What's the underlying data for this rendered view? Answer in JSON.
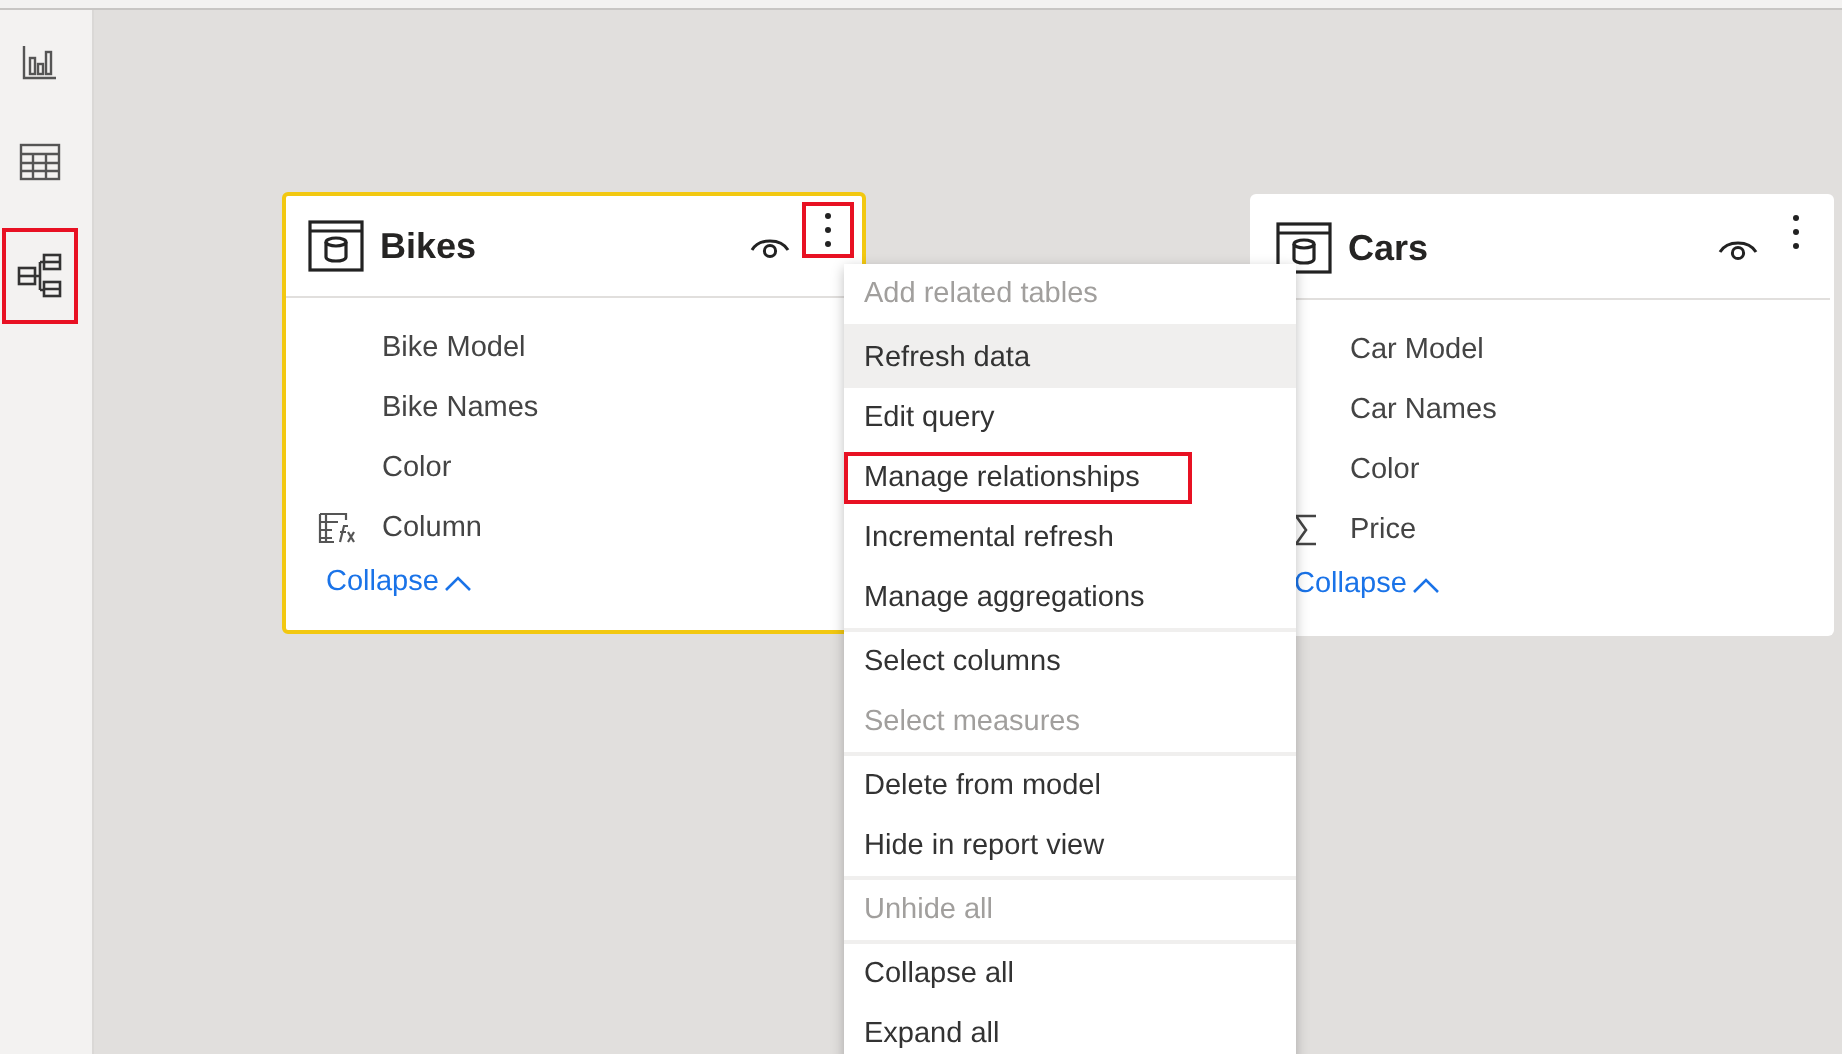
{
  "nav": [
    {
      "kind": "report",
      "highlighted": false
    },
    {
      "kind": "data",
      "highlighted": false
    },
    {
      "kind": "model",
      "highlighted": true
    }
  ],
  "tables": [
    {
      "name": "Bikes",
      "selected": true,
      "more_highlighted": true,
      "collapse_label": "Collapse",
      "fields": [
        {
          "name": "Bike Model",
          "kind": "column"
        },
        {
          "name": "Bike Names",
          "kind": "column"
        },
        {
          "name": "Color",
          "kind": "column"
        },
        {
          "name": "Column",
          "kind": "calculated"
        }
      ]
    },
    {
      "name": "Cars",
      "selected": false,
      "more_highlighted": false,
      "collapse_label": "Collapse",
      "fields": [
        {
          "name": "Car Model",
          "kind": "column"
        },
        {
          "name": "Car Names",
          "kind": "column"
        },
        {
          "name": "Color",
          "kind": "column"
        },
        {
          "name": "Price",
          "kind": "sum"
        }
      ]
    }
  ],
  "menu": {
    "groups": [
      [
        {
          "label": "Add related tables",
          "disabled": true,
          "hovered": false,
          "highlighted": false
        }
      ],
      [
        {
          "label": "Refresh data",
          "disabled": false,
          "hovered": true,
          "highlighted": false
        },
        {
          "label": "Edit query",
          "disabled": false,
          "hovered": false,
          "highlighted": false
        },
        {
          "label": "Manage relationships",
          "disabled": false,
          "hovered": false,
          "highlighted": true
        },
        {
          "label": "Incremental refresh",
          "disabled": false,
          "hovered": false,
          "highlighted": false
        },
        {
          "label": "Manage aggregations",
          "disabled": false,
          "hovered": false,
          "highlighted": false
        }
      ],
      [
        {
          "label": "Select columns",
          "disabled": false,
          "hovered": false,
          "highlighted": false
        },
        {
          "label": "Select measures",
          "disabled": true,
          "hovered": false,
          "highlighted": false
        }
      ],
      [
        {
          "label": "Delete from model",
          "disabled": false,
          "hovered": false,
          "highlighted": false
        },
        {
          "label": "Hide in report view",
          "disabled": false,
          "hovered": false,
          "highlighted": false
        }
      ],
      [
        {
          "label": "Unhide all",
          "disabled": true,
          "hovered": false,
          "highlighted": false
        }
      ],
      [
        {
          "label": "Collapse all",
          "disabled": false,
          "hovered": false,
          "highlighted": false
        },
        {
          "label": "Expand all",
          "disabled": false,
          "hovered": false,
          "highlighted": false
        }
      ]
    ]
  }
}
